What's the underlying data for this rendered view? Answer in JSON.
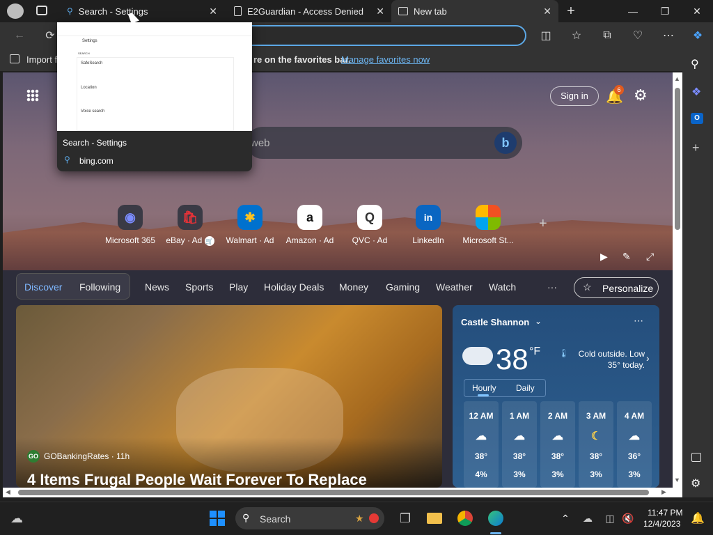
{
  "tabs": [
    {
      "label": "Search - Settings",
      "active": false
    },
    {
      "label": "E2Guardian - Access Denied",
      "active": false
    },
    {
      "label": "New tab",
      "active": true
    }
  ],
  "favorites_bar": {
    "import_label": "Import f",
    "message_fragment": "re on the favorites bar.",
    "manage_link": "Manage favorites now"
  },
  "tab_preview": {
    "title": "Search - Settings",
    "url": "bing.com",
    "thumbnail_text": {
      "settings": "Settings",
      "section": "SEARCH",
      "safesearch": "SafeSearch",
      "location": "Location",
      "voice": "Voice search"
    }
  },
  "new_tab": {
    "search_placeholder_fragment": "web",
    "sign_in": "Sign in",
    "notification_count": "6",
    "quick_links": [
      {
        "label": "Microsoft 365",
        "icon": "microsoft-365-icon"
      },
      {
        "label": "eBay · Ad",
        "icon": "ebay-icon"
      },
      {
        "label": "Walmart · Ad",
        "icon": "walmart-icon"
      },
      {
        "label": "Amazon · Ad",
        "icon": "amazon-icon"
      },
      {
        "label": "QVC · Ad",
        "icon": "qvc-icon"
      },
      {
        "label": "LinkedIn",
        "icon": "linkedin-icon"
      },
      {
        "label": "Microsoft St...",
        "icon": "microsoft-store-icon"
      }
    ],
    "nav": [
      "Discover",
      "Following",
      "News",
      "Sports",
      "Play",
      "Holiday Deals",
      "Money",
      "Gaming",
      "Weather",
      "Watch"
    ],
    "nav_more": "···",
    "personalize": "Personalize"
  },
  "news": {
    "source": "GOBankingRates · 11h",
    "source_logo": "GO",
    "headline": "4 Items Frugal People Wait Forever To Replace"
  },
  "weather": {
    "location": "Castle Shannon",
    "temp": "38",
    "unit": "°F",
    "summary": "Cold outside. Low 35° today.",
    "tabs": [
      "Hourly",
      "Daily"
    ],
    "hours": [
      {
        "time": "12 AM",
        "temp": "38°",
        "precip": "4%"
      },
      {
        "time": "1 AM",
        "temp": "38°",
        "precip": "3%"
      },
      {
        "time": "2 AM",
        "temp": "38°",
        "precip": "3%"
      },
      {
        "time": "3 AM",
        "temp": "38°",
        "precip": "3%"
      },
      {
        "time": "4 AM",
        "temp": "36°",
        "precip": "3%"
      }
    ]
  },
  "taskbar": {
    "search_label": "Search",
    "time": "11:47 PM",
    "date": "12/4/2023"
  },
  "colors": {
    "accent": "#5ca8e6",
    "link": "#6cb4f0",
    "badge": "#e05a1f"
  }
}
